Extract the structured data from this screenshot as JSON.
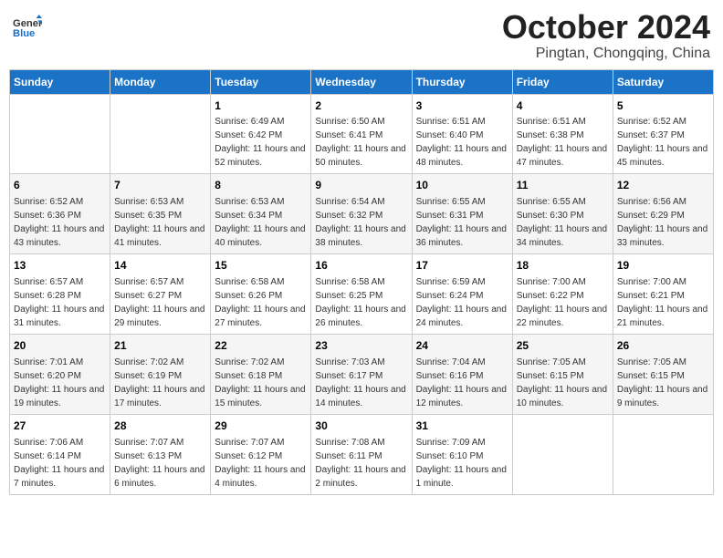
{
  "header": {
    "logo_general": "General",
    "logo_blue": "Blue",
    "month_title": "October 2024",
    "location": "Pingtan, Chongqing, China"
  },
  "days_of_week": [
    "Sunday",
    "Monday",
    "Tuesday",
    "Wednesday",
    "Thursday",
    "Friday",
    "Saturday"
  ],
  "weeks": [
    [
      {
        "day": "",
        "info": ""
      },
      {
        "day": "",
        "info": ""
      },
      {
        "day": "1",
        "info": "Sunrise: 6:49 AM\nSunset: 6:42 PM\nDaylight: 11 hours and 52 minutes."
      },
      {
        "day": "2",
        "info": "Sunrise: 6:50 AM\nSunset: 6:41 PM\nDaylight: 11 hours and 50 minutes."
      },
      {
        "day": "3",
        "info": "Sunrise: 6:51 AM\nSunset: 6:40 PM\nDaylight: 11 hours and 48 minutes."
      },
      {
        "day": "4",
        "info": "Sunrise: 6:51 AM\nSunset: 6:38 PM\nDaylight: 11 hours and 47 minutes."
      },
      {
        "day": "5",
        "info": "Sunrise: 6:52 AM\nSunset: 6:37 PM\nDaylight: 11 hours and 45 minutes."
      }
    ],
    [
      {
        "day": "6",
        "info": "Sunrise: 6:52 AM\nSunset: 6:36 PM\nDaylight: 11 hours and 43 minutes."
      },
      {
        "day": "7",
        "info": "Sunrise: 6:53 AM\nSunset: 6:35 PM\nDaylight: 11 hours and 41 minutes."
      },
      {
        "day": "8",
        "info": "Sunrise: 6:53 AM\nSunset: 6:34 PM\nDaylight: 11 hours and 40 minutes."
      },
      {
        "day": "9",
        "info": "Sunrise: 6:54 AM\nSunset: 6:32 PM\nDaylight: 11 hours and 38 minutes."
      },
      {
        "day": "10",
        "info": "Sunrise: 6:55 AM\nSunset: 6:31 PM\nDaylight: 11 hours and 36 minutes."
      },
      {
        "day": "11",
        "info": "Sunrise: 6:55 AM\nSunset: 6:30 PM\nDaylight: 11 hours and 34 minutes."
      },
      {
        "day": "12",
        "info": "Sunrise: 6:56 AM\nSunset: 6:29 PM\nDaylight: 11 hours and 33 minutes."
      }
    ],
    [
      {
        "day": "13",
        "info": "Sunrise: 6:57 AM\nSunset: 6:28 PM\nDaylight: 11 hours and 31 minutes."
      },
      {
        "day": "14",
        "info": "Sunrise: 6:57 AM\nSunset: 6:27 PM\nDaylight: 11 hours and 29 minutes."
      },
      {
        "day": "15",
        "info": "Sunrise: 6:58 AM\nSunset: 6:26 PM\nDaylight: 11 hours and 27 minutes."
      },
      {
        "day": "16",
        "info": "Sunrise: 6:58 AM\nSunset: 6:25 PM\nDaylight: 11 hours and 26 minutes."
      },
      {
        "day": "17",
        "info": "Sunrise: 6:59 AM\nSunset: 6:24 PM\nDaylight: 11 hours and 24 minutes."
      },
      {
        "day": "18",
        "info": "Sunrise: 7:00 AM\nSunset: 6:22 PM\nDaylight: 11 hours and 22 minutes."
      },
      {
        "day": "19",
        "info": "Sunrise: 7:00 AM\nSunset: 6:21 PM\nDaylight: 11 hours and 21 minutes."
      }
    ],
    [
      {
        "day": "20",
        "info": "Sunrise: 7:01 AM\nSunset: 6:20 PM\nDaylight: 11 hours and 19 minutes."
      },
      {
        "day": "21",
        "info": "Sunrise: 7:02 AM\nSunset: 6:19 PM\nDaylight: 11 hours and 17 minutes."
      },
      {
        "day": "22",
        "info": "Sunrise: 7:02 AM\nSunset: 6:18 PM\nDaylight: 11 hours and 15 minutes."
      },
      {
        "day": "23",
        "info": "Sunrise: 7:03 AM\nSunset: 6:17 PM\nDaylight: 11 hours and 14 minutes."
      },
      {
        "day": "24",
        "info": "Sunrise: 7:04 AM\nSunset: 6:16 PM\nDaylight: 11 hours and 12 minutes."
      },
      {
        "day": "25",
        "info": "Sunrise: 7:05 AM\nSunset: 6:15 PM\nDaylight: 11 hours and 10 minutes."
      },
      {
        "day": "26",
        "info": "Sunrise: 7:05 AM\nSunset: 6:15 PM\nDaylight: 11 hours and 9 minutes."
      }
    ],
    [
      {
        "day": "27",
        "info": "Sunrise: 7:06 AM\nSunset: 6:14 PM\nDaylight: 11 hours and 7 minutes."
      },
      {
        "day": "28",
        "info": "Sunrise: 7:07 AM\nSunset: 6:13 PM\nDaylight: 11 hours and 6 minutes."
      },
      {
        "day": "29",
        "info": "Sunrise: 7:07 AM\nSunset: 6:12 PM\nDaylight: 11 hours and 4 minutes."
      },
      {
        "day": "30",
        "info": "Sunrise: 7:08 AM\nSunset: 6:11 PM\nDaylight: 11 hours and 2 minutes."
      },
      {
        "day": "31",
        "info": "Sunrise: 7:09 AM\nSunset: 6:10 PM\nDaylight: 11 hours and 1 minute."
      },
      {
        "day": "",
        "info": ""
      },
      {
        "day": "",
        "info": ""
      }
    ]
  ]
}
